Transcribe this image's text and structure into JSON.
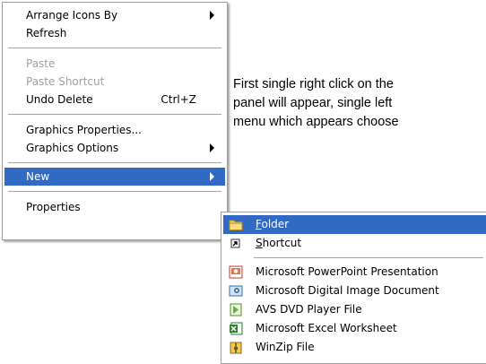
{
  "context_menu": {
    "items": [
      {
        "label": "Arrange Icons By",
        "submenu": true
      },
      {
        "label": "Refresh"
      },
      {
        "label": "Paste",
        "disabled": true
      },
      {
        "label": "Paste Shortcut",
        "disabled": true
      },
      {
        "label": "Undo Delete",
        "shortcut": "Ctrl+Z"
      },
      {
        "label": "Graphics Properties..."
      },
      {
        "label": "Graphics Options",
        "submenu": true
      },
      {
        "label": "New",
        "submenu": true,
        "selected": true
      },
      {
        "label": "Properties"
      }
    ]
  },
  "new_submenu": {
    "items": [
      {
        "label": "Folder",
        "mnemonic": "F",
        "rest": "older",
        "icon": "folder-icon",
        "selected": true
      },
      {
        "label": "Shortcut",
        "mnemonic": "S",
        "rest": "hortcut",
        "icon": "shortcut-icon"
      },
      {
        "label": "Microsoft PowerPoint Presentation",
        "icon": "powerpoint-icon"
      },
      {
        "label": "Microsoft Digital Image Document",
        "icon": "digital-image-icon"
      },
      {
        "label": "AVS DVD Player File",
        "icon": "dvd-player-icon"
      },
      {
        "label": "Microsoft Excel Worksheet",
        "icon": "excel-icon"
      },
      {
        "label": "WinZip File",
        "icon": "winzip-icon"
      }
    ]
  },
  "instruction": {
    "lines": [
      "First single right click on the",
      "panel will appear, single left",
      "menu which appears choose"
    ]
  },
  "colors": {
    "highlight": "#316ac5",
    "disabled_text": "#a0a0a0",
    "menu_border": "#9d9d9d"
  }
}
